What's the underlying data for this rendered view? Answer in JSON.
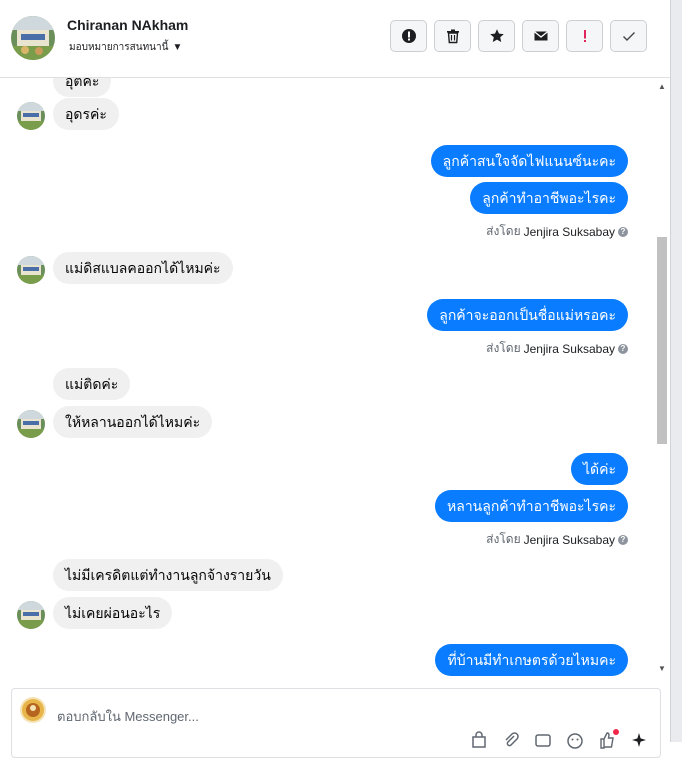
{
  "header": {
    "contact_name": "Chiranan NAkham",
    "assign_label": "มอบหมายการสนทนานี้",
    "actions": [
      {
        "name": "report-icon"
      },
      {
        "name": "trash-icon"
      },
      {
        "name": "star-icon"
      },
      {
        "name": "mail-icon"
      },
      {
        "name": "exclamation-icon",
        "color": "#e0245e"
      },
      {
        "name": "check-icon"
      }
    ]
  },
  "messages": [
    {
      "dir": "in",
      "text": "อุตค่ะ"
    },
    {
      "dir": "in",
      "text": "อุดรค่ะ"
    },
    {
      "dir": "out",
      "text": "ลูกค้าสนใจจัดไฟแนนซ์นะคะ"
    },
    {
      "dir": "out",
      "text": "ลูกค้าทำอาชีพอะไรคะ"
    },
    {
      "dir": "in",
      "text": "แม่ดิสแบลคออกได้ไหมค่ะ"
    },
    {
      "dir": "out",
      "text": "ลูกค้าจะออกเป็นชื่อแม่หรอคะ"
    },
    {
      "dir": "in",
      "text": "แม่ติดค่ะ"
    },
    {
      "dir": "in",
      "text": "ให้หลานออกได้ไหมค่ะ"
    },
    {
      "dir": "out",
      "text": "ได้ค่ะ"
    },
    {
      "dir": "out",
      "text": "หลานลูกค้าทำอาชีพอะไรคะ"
    },
    {
      "dir": "in",
      "text": "ไม่มีเครดิตแต่ทำงานลูกจ้างรายวัน"
    },
    {
      "dir": "in",
      "text": "ไม่เคยผ่อนอะไร"
    },
    {
      "dir": "out",
      "text": "ที่บ้านมีทำเกษตรด้วยไหมคะ"
    }
  ],
  "sent_by": {
    "prefix": "ส่งโดย",
    "name": "Jenjira Suksabay"
  },
  "composer": {
    "placeholder": "ตอบกลับใน Messenger...",
    "tools": [
      "bag-icon",
      "paperclip-icon",
      "gif-icon",
      "emoji-icon",
      "like-icon",
      "sparkle-icon"
    ]
  },
  "colors": {
    "outgoing_bubble": "#0a7cff",
    "incoming_bubble": "#f0f0f0"
  }
}
